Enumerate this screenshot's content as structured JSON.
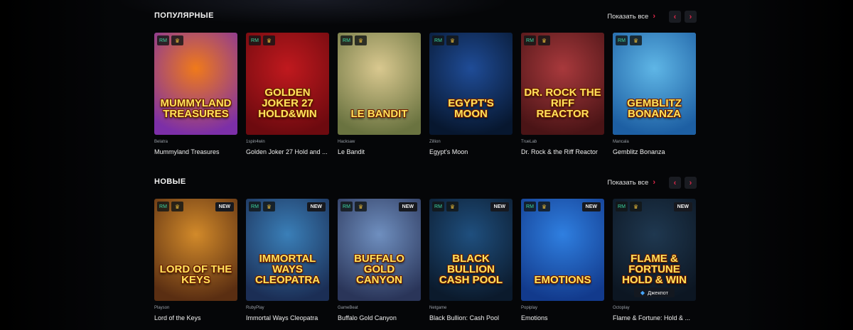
{
  "sections": [
    {
      "title": "ПОПУЛЯРНЫЕ",
      "show_all": "Показать все",
      "games": [
        {
          "provider": "Belatra",
          "name": "Mummyland Treasures",
          "art": "MUMMYLAND TREASURES",
          "colors": [
            "#f07a1a",
            "#7c2fa8"
          ],
          "new": false,
          "jackpot": false
        },
        {
          "provider": "1spin4win",
          "name": "Golden Joker 27 Hold and ...",
          "art": "GOLDEN JOKER 27 HOLD&WIN",
          "colors": [
            "#c0191e",
            "#6d0a0f"
          ],
          "new": false,
          "jackpot": false
        },
        {
          "provider": "Hacksaw",
          "name": "Le Bandit",
          "art": "LE BANDIT",
          "colors": [
            "#d9c88f",
            "#6a7340"
          ],
          "new": false,
          "jackpot": false
        },
        {
          "provider": "Zillion",
          "name": "Egypt's Moon",
          "art": "EGYPT'S MOON",
          "colors": [
            "#1f4c97",
            "#07172f"
          ],
          "new": false,
          "jackpot": false
        },
        {
          "provider": "TrueLab",
          "name": "Dr. Rock & the Riff Reactor",
          "art": "DR. ROCK THE RIFF REACTOR",
          "colors": [
            "#a8393c",
            "#4a1416"
          ],
          "new": false,
          "jackpot": false
        },
        {
          "provider": "Mancala",
          "name": "Gemblitz Bonanza",
          "art": "GEMBLITZ BONANZA",
          "colors": [
            "#5fb6e6",
            "#1d5fa3"
          ],
          "new": false,
          "jackpot": false
        }
      ]
    },
    {
      "title": "НОВЫЕ",
      "show_all": "Показать все",
      "games": [
        {
          "provider": "Playson",
          "name": "Lord of the Keys",
          "art": "LORD OF THE KEYS",
          "colors": [
            "#d28a2a",
            "#5a2e12"
          ],
          "new": true,
          "jackpot": false
        },
        {
          "provider": "RubyPlay",
          "name": "Immortal Ways Cleopatra",
          "art": "IMMORTAL WAYS CLEOPATRA",
          "colors": [
            "#3a7fb8",
            "#1b2e55"
          ],
          "new": true,
          "jackpot": false
        },
        {
          "provider": "GameBeat",
          "name": "Buffalo Gold Canyon",
          "art": "BUFFALO GOLD CANYON",
          "colors": [
            "#6f8fbf",
            "#2a3559"
          ],
          "new": true,
          "jackpot": false
        },
        {
          "provider": "Netgame",
          "name": "Black Bullion: Cash Pool",
          "art": "BLACK BULLION CASH POOL",
          "colors": [
            "#1f4f7e",
            "#0b1a2c"
          ],
          "new": true,
          "jackpot": false
        },
        {
          "provider": "Popiplay",
          "name": "Emotions",
          "art": "EMOTIONS",
          "colors": [
            "#2f7fe0",
            "#123a8c"
          ],
          "new": true,
          "jackpot": false
        },
        {
          "provider": "Octoplay",
          "name": "Flame & Fortune: Hold & ...",
          "art": "FLAME & FORTUNE HOLD & WIN",
          "colors": [
            "#1f3850",
            "#0c1622"
          ],
          "new": true,
          "jackpot": true
        }
      ]
    }
  ],
  "badges": {
    "rm": "RM",
    "cup": "♛",
    "new": "NEW",
    "jackpot": "Джекпот",
    "jackpot_icon": "diamond-icon"
  },
  "nav": {
    "prev": "‹",
    "next": "›",
    "chevron": "›"
  }
}
